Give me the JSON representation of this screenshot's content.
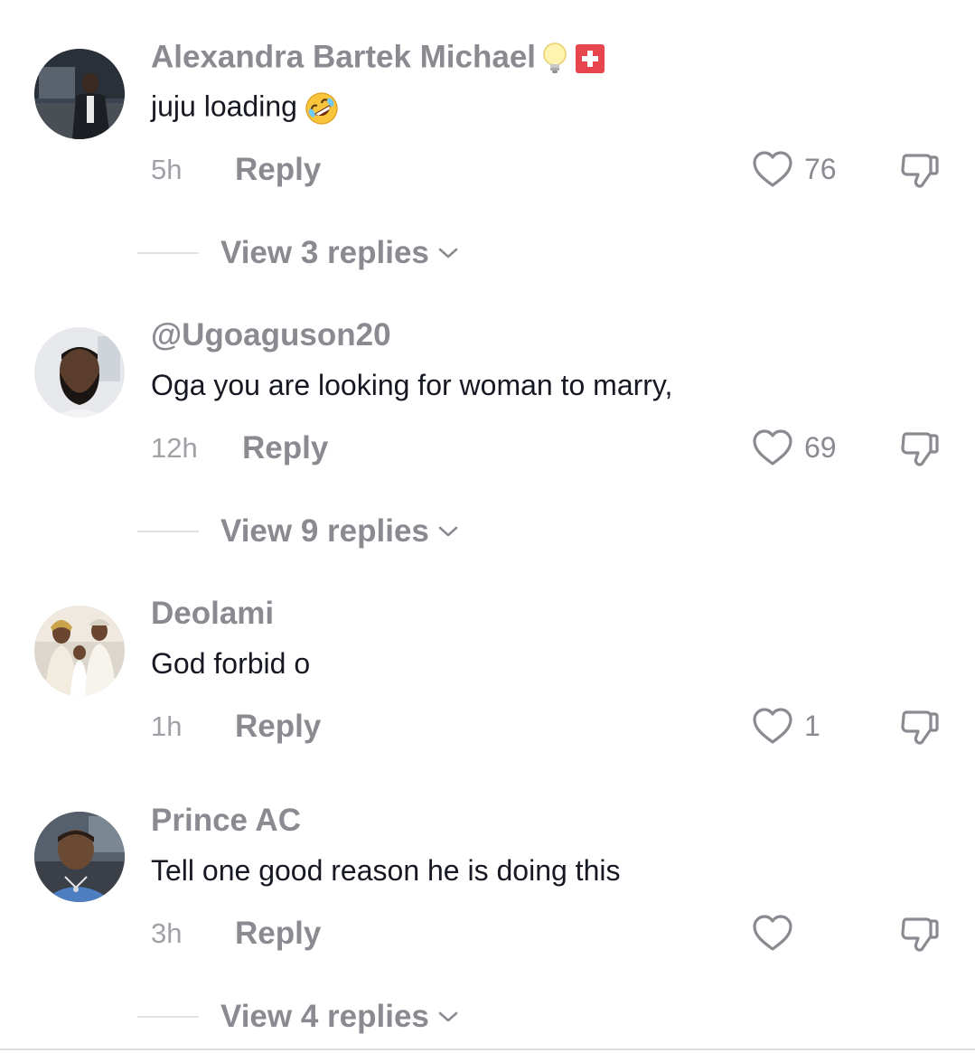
{
  "comments": [
    {
      "username": "Alexandra Bartek Michael",
      "username_emojis": [
        "light-bulb",
        "swiss-flag"
      ],
      "text": "juju loading",
      "text_emoji": "rolling-on-floor-laughing",
      "time": "5h",
      "reply_label": "Reply",
      "likes": "76",
      "view_replies": "View 3 replies"
    },
    {
      "username": "@Ugoaguson20",
      "text": "Oga you are looking for woman to marry,",
      "time": "12h",
      "reply_label": "Reply",
      "likes": "69",
      "view_replies": "View 9 replies"
    },
    {
      "username": "Deolami",
      "text": "God forbid o",
      "time": "1h",
      "reply_label": "Reply",
      "likes": "1"
    },
    {
      "username": "Prince AC",
      "text": "Tell one good reason he is doing this",
      "time": "3h",
      "reply_label": "Reply",
      "likes": "",
      "view_replies": "View 4 replies"
    }
  ],
  "colors": {
    "username": "#8a8b91",
    "text": "#161823",
    "meta": "#a0a1a7",
    "divider": "#e3e3e4"
  },
  "icons": {
    "like": "heart-outline-icon",
    "dislike": "thumbs-down-outline-icon",
    "expand": "chevron-down-icon"
  }
}
